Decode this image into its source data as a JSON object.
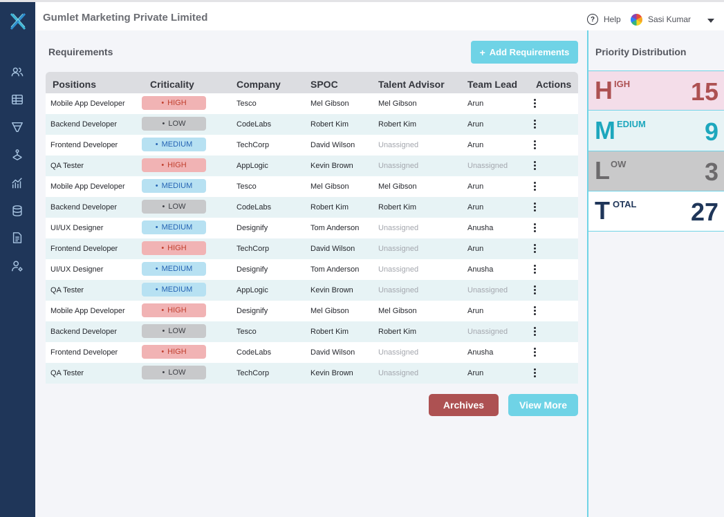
{
  "header": {
    "company": "Gumlet Marketing Private Limited",
    "help": "Help",
    "user": "Sasi Kumar"
  },
  "sidebar": {
    "items": [
      {
        "icon": "users-icon"
      },
      {
        "icon": "table-icon"
      },
      {
        "icon": "funnel-icon"
      },
      {
        "icon": "network-icon"
      },
      {
        "icon": "analytics-icon"
      },
      {
        "icon": "database-icon"
      },
      {
        "icon": "document-icon"
      },
      {
        "icon": "user-settings-icon"
      }
    ]
  },
  "main": {
    "title": "Requirements",
    "add_button": "Add Requirements",
    "archives_button": "Archives",
    "view_more_button": "View More",
    "columns": [
      "Positions",
      "Criticality",
      "Company",
      "SPOC",
      "Talent Advisor",
      "Team Lead",
      "Actions"
    ],
    "rows": [
      {
        "position": "Mobile App Developer",
        "criticality": "HIGH",
        "level": "high",
        "company": "Tesco",
        "spoc": "Mel Gibson",
        "advisor": "Mel Gibson",
        "lead": "Arun"
      },
      {
        "position": "Backend Developer",
        "criticality": "LOW",
        "level": "low",
        "company": "CodeLabs",
        "spoc": "Robert Kim",
        "advisor": "Robert Kim",
        "lead": "Arun"
      },
      {
        "position": "Frontend Developer",
        "criticality": "MEDIUM",
        "level": "medium",
        "company": "TechCorp",
        "spoc": "David Wilson",
        "advisor": "Unassigned",
        "lead": "Arun"
      },
      {
        "position": "QA Tester",
        "criticality": "HIGH",
        "level": "high",
        "company": "AppLogic",
        "spoc": "Kevin Brown",
        "advisor": "Unassigned",
        "lead": "Unassigned"
      },
      {
        "position": "Mobile App Developer",
        "criticality": "MEDIUM",
        "level": "medium",
        "company": "Tesco",
        "spoc": "Mel Gibson",
        "advisor": "Mel Gibson",
        "lead": "Arun"
      },
      {
        "position": "Backend Developer",
        "criticality": "LOW",
        "level": "low",
        "company": "CodeLabs",
        "spoc": "Robert Kim",
        "advisor": "Robert Kim",
        "lead": "Arun"
      },
      {
        "position": "UI/UX Designer",
        "criticality": "MEDIUM",
        "level": "medium",
        "company": "Designify",
        "spoc": "Tom Anderson",
        "advisor": "Unassigned",
        "lead": "Anusha"
      },
      {
        "position": "Frontend Developer",
        "criticality": "HIGH",
        "level": "high",
        "company": "TechCorp",
        "spoc": "David Wilson",
        "advisor": "Unassigned",
        "lead": "Arun"
      },
      {
        "position": "UI/UX Designer",
        "criticality": "MEDIUM",
        "level": "medium",
        "company": "Designify",
        "spoc": "Tom Anderson",
        "advisor": "Unassigned",
        "lead": "Anusha"
      },
      {
        "position": "QA Tester",
        "criticality": "MEDIUM",
        "level": "medium",
        "company": "AppLogic",
        "spoc": "Kevin Brown",
        "advisor": "Unassigned",
        "lead": "Unassigned"
      },
      {
        "position": "Mobile App Developer",
        "criticality": "HIGH",
        "level": "high",
        "company": "Designify",
        "spoc": "Mel Gibson",
        "advisor": "Mel Gibson",
        "lead": "Arun"
      },
      {
        "position": "Backend Developer",
        "criticality": "LOW",
        "level": "low",
        "company": "Tesco",
        "spoc": "Robert Kim",
        "advisor": "Robert Kim",
        "lead": "Unassigned"
      },
      {
        "position": "Frontend Developer",
        "criticality": "HIGH",
        "level": "high",
        "company": "CodeLabs",
        "spoc": "David Wilson",
        "advisor": "Unassigned",
        "lead": "Anusha"
      },
      {
        "position": "QA Tester",
        "criticality": "LOW",
        "level": "low",
        "company": "TechCorp",
        "spoc": "Kevin Brown",
        "advisor": "Unassigned",
        "lead": "Arun"
      }
    ]
  },
  "priority": {
    "title": "Priority Distribution",
    "items": [
      {
        "level": "high",
        "initial": "H",
        "rest": "IGH",
        "count": "15"
      },
      {
        "level": "medium",
        "initial": "M",
        "rest": "EDIUM",
        "count": "9"
      },
      {
        "level": "low",
        "initial": "L",
        "rest": "OW",
        "count": "3"
      },
      {
        "level": "total",
        "initial": "T",
        "rest": "OTAL",
        "count": "27"
      }
    ]
  },
  "colors": {
    "sidebar": "#1f3659",
    "accent": "#6fd3e6",
    "high": "#ad5152",
    "medium": "#1da7bd",
    "low": "#6c6a6c"
  }
}
